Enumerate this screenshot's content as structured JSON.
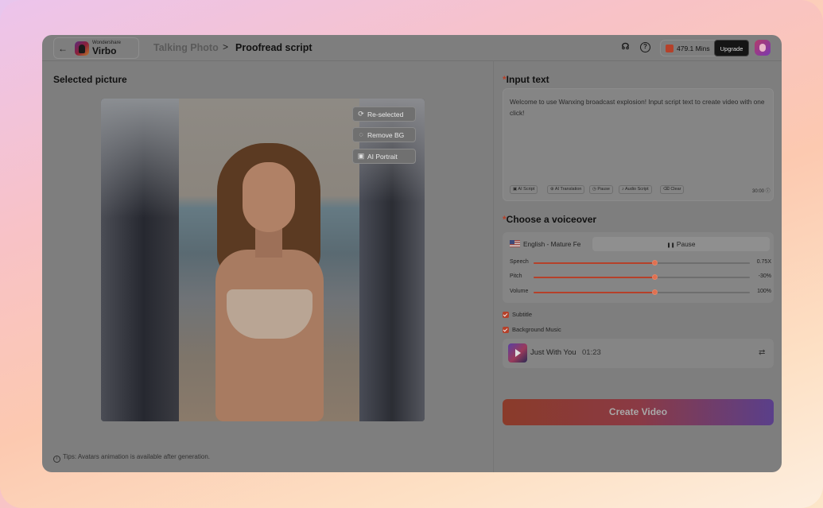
{
  "header": {
    "brand_small": "Wondershare",
    "brand_big": "Virbo",
    "crumb_parent": "Talking Photo",
    "crumb_sep": ">",
    "crumb_current": "Proofread script",
    "help_symbol": "?",
    "minutes": "479.1 Mins",
    "upgrade_label": "Upgrade"
  },
  "left": {
    "title": "Selected picture",
    "buttons": [
      {
        "label": "Re-selected",
        "icon": "refresh-icon",
        "glyph": "⟳"
      },
      {
        "label": "Remove BG",
        "icon": "remove-bg-icon",
        "glyph": "◌"
      },
      {
        "label": "AI Portrait",
        "icon": "portrait-icon",
        "glyph": "▣"
      }
    ],
    "tip_symbol": "i",
    "tip": "Tips: Avatars animation is available after generation."
  },
  "input": {
    "required_mark": "*",
    "title": "Input text",
    "text": "Welcome to use Wanxing broadcast explosion! Input script text to create video with one click!",
    "tools": [
      "AI Script",
      "AI Translation",
      "Pause",
      "Audio Script",
      "Clear"
    ],
    "counter": "30:00"
  },
  "voiceover": {
    "required_mark": "*",
    "title": "Choose a voiceover",
    "voice": "English - Mature Fe",
    "pause_label": "Pause",
    "pause_glyph": "❚❚",
    "sliders": [
      {
        "label": "Speech",
        "value": "0.75X",
        "position": 0.56
      },
      {
        "label": "Pitch",
        "value": "-30%",
        "position": 0.56
      },
      {
        "label": "Volume",
        "value": "100%",
        "position": 0.56
      }
    ]
  },
  "options": {
    "subtitle": "Subtitle",
    "background_music": "Background Music"
  },
  "music": {
    "name": "Just With You",
    "duration": "01:23",
    "replace_glyph": "⇄"
  },
  "create_label": "Create Video",
  "colors": {
    "accent": "#b5412a",
    "overlay_gray": "#7e7e7e"
  }
}
